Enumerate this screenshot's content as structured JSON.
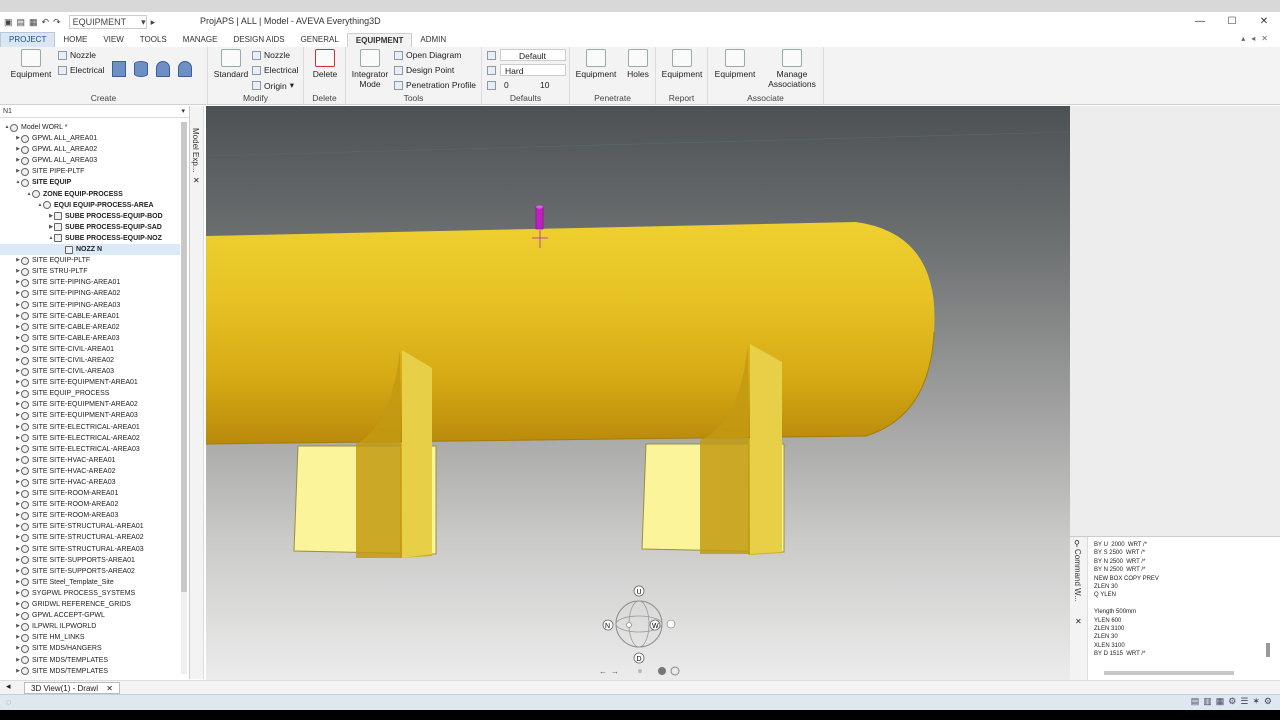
{
  "window": {
    "title": "ProjAPS | ALL | Model - AVEVA Everything3D",
    "quick_combo": "EQUIPMENT",
    "buttons": [
      "—",
      "☐",
      "✕"
    ]
  },
  "tabs": [
    "PROJECT",
    "HOME",
    "VIEW",
    "TOOLS",
    "MANAGE",
    "DESIGN AIDS",
    "GENERAL",
    "EQUIPMENT",
    "ADMIN"
  ],
  "ribbon": {
    "create": {
      "label": "Create",
      "equipment": "Equipment",
      "nozzle": "Nozzle",
      "electrical": "Electrical"
    },
    "modify": {
      "label": "Modify",
      "standard": "Standard",
      "nozzle": "Nozzle",
      "electrical": "Electrical",
      "origin": "Origin"
    },
    "delete": {
      "label": "Delete",
      "delete": "Delete"
    },
    "tools": {
      "label": "Tools",
      "integrator": "Integrator",
      "mode": "Mode",
      "open_diagram": "Open Diagram",
      "design_point": "Design Point",
      "penetration_profile": "Penetration Profile"
    },
    "defaults": {
      "label": "Defaults",
      "default": "Default",
      "hard": "Hard",
      "val1": "0",
      "val2": "10"
    },
    "penetrate": {
      "label": "Penetrate",
      "equipment": "Equipment",
      "holes": "Holes"
    },
    "report": {
      "label": "Report",
      "equipment": "Equipment"
    },
    "associate": {
      "label": "Associate",
      "equipment": "Equipment",
      "manage": "Manage",
      "associations": "Associations"
    }
  },
  "tree": {
    "header": "N1",
    "items": [
      {
        "label": "Model WORL *",
        "indent": 0,
        "exp": "▲",
        "bold": false
      },
      {
        "label": "GPWL ALL_AREA01",
        "indent": 1,
        "exp": "▶",
        "bold": false
      },
      {
        "label": "GPWL ALL_AREA02",
        "indent": 1,
        "exp": "▶",
        "bold": false
      },
      {
        "label": "GPWL ALL_AREA03",
        "indent": 1,
        "exp": "▶",
        "bold": false
      },
      {
        "label": "SITE PIPE-PLTF",
        "indent": 1,
        "exp": "▶",
        "bold": false
      },
      {
        "label": "SITE EQUIP",
        "indent": 1,
        "exp": "▲",
        "bold": true
      },
      {
        "label": "ZONE EQUIP-PROCESS",
        "indent": 2,
        "exp": "▲",
        "bold": true
      },
      {
        "label": "EQUI EQUIP-PROCESS-AREA",
        "indent": 3,
        "exp": "▲",
        "bold": true
      },
      {
        "label": "SUBE PROCESS-EQUIP-BOD",
        "indent": 4,
        "exp": "▶",
        "bold": true
      },
      {
        "label": "SUBE PROCESS-EQUIP-SAD",
        "indent": 4,
        "exp": "▶",
        "bold": true
      },
      {
        "label": "SUBE PROCESS-EQUIP-NOZ",
        "indent": 4,
        "exp": "▲",
        "bold": true
      },
      {
        "label": "NOZZ N",
        "indent": 5,
        "exp": "",
        "bold": true,
        "sel": true
      },
      {
        "label": "SITE EQUIP-PLTF",
        "indent": 1,
        "exp": "▶",
        "bold": false
      },
      {
        "label": "SITE STRU-PLTF",
        "indent": 1,
        "exp": "▶",
        "bold": false
      },
      {
        "label": "SITE SITE-PIPING-AREA01",
        "indent": 1,
        "exp": "▶",
        "bold": false
      },
      {
        "label": "SITE SITE-PIPING-AREA02",
        "indent": 1,
        "exp": "▶",
        "bold": false
      },
      {
        "label": "SITE SITE-PIPING-AREA03",
        "indent": 1,
        "exp": "▶",
        "bold": false
      },
      {
        "label": "SITE SITE-CABLE-AREA01",
        "indent": 1,
        "exp": "▶",
        "bold": false
      },
      {
        "label": "SITE SITE-CABLE-AREA02",
        "indent": 1,
        "exp": "▶",
        "bold": false
      },
      {
        "label": "SITE SITE-CABLE-AREA03",
        "indent": 1,
        "exp": "▶",
        "bold": false
      },
      {
        "label": "SITE SITE-CIVIL-AREA01",
        "indent": 1,
        "exp": "▶",
        "bold": false
      },
      {
        "label": "SITE SITE-CIVIL-AREA02",
        "indent": 1,
        "exp": "▶",
        "bold": false
      },
      {
        "label": "SITE SITE-CIVIL-AREA03",
        "indent": 1,
        "exp": "▶",
        "bold": false
      },
      {
        "label": "SITE SITE-EQUIPMENT-AREA01",
        "indent": 1,
        "exp": "▶",
        "bold": false
      },
      {
        "label": "SITE EQUIP_PROCESS",
        "indent": 1,
        "exp": "▶",
        "bold": false
      },
      {
        "label": "SITE SITE-EQUIPMENT-AREA02",
        "indent": 1,
        "exp": "▶",
        "bold": false
      },
      {
        "label": "SITE SITE-EQUIPMENT-AREA03",
        "indent": 1,
        "exp": "▶",
        "bold": false
      },
      {
        "label": "SITE SITE-ELECTRICAL-AREA01",
        "indent": 1,
        "exp": "▶",
        "bold": false
      },
      {
        "label": "SITE SITE-ELECTRICAL-AREA02",
        "indent": 1,
        "exp": "▶",
        "bold": false
      },
      {
        "label": "SITE SITE-ELECTRICAL-AREA03",
        "indent": 1,
        "exp": "▶",
        "bold": false
      },
      {
        "label": "SITE SITE-HVAC-AREA01",
        "indent": 1,
        "exp": "▶",
        "bold": false
      },
      {
        "label": "SITE SITE-HVAC-AREA02",
        "indent": 1,
        "exp": "▶",
        "bold": false
      },
      {
        "label": "SITE SITE-HVAC-AREA03",
        "indent": 1,
        "exp": "▶",
        "bold": false
      },
      {
        "label": "SITE SITE-ROOM-AREA01",
        "indent": 1,
        "exp": "▶",
        "bold": false
      },
      {
        "label": "SITE SITE-ROOM-AREA02",
        "indent": 1,
        "exp": "▶",
        "bold": false
      },
      {
        "label": "SITE SITE-ROOM-AREA03",
        "indent": 1,
        "exp": "▶",
        "bold": false
      },
      {
        "label": "SITE SITE-STRUCTURAL-AREA01",
        "indent": 1,
        "exp": "▶",
        "bold": false
      },
      {
        "label": "SITE SITE-STRUCTURAL-AREA02",
        "indent": 1,
        "exp": "▶",
        "bold": false
      },
      {
        "label": "SITE SITE-STRUCTURAL-AREA03",
        "indent": 1,
        "exp": "▶",
        "bold": false
      },
      {
        "label": "SITE SITE-SUPPORTS-AREA01",
        "indent": 1,
        "exp": "▶",
        "bold": false
      },
      {
        "label": "SITE SITE-SUPPORTS-AREA02",
        "indent": 1,
        "exp": "▶",
        "bold": false
      },
      {
        "label": "SITE Steel_Template_Site",
        "indent": 1,
        "exp": "▶",
        "bold": false
      },
      {
        "label": "SYGPWL PROCESS_SYSTEMS",
        "indent": 1,
        "exp": "▶",
        "bold": false
      },
      {
        "label": "GRIDWL REFERENCE_GRIDS",
        "indent": 1,
        "exp": "▶",
        "bold": false
      },
      {
        "label": "GPWL ACCEPT-GPWL",
        "indent": 1,
        "exp": "▶",
        "bold": false
      },
      {
        "label": "ILPWRL ILPWORLD",
        "indent": 1,
        "exp": "▶",
        "bold": false
      },
      {
        "label": "SITE HM_LINKS",
        "indent": 1,
        "exp": "▶",
        "bold": false
      },
      {
        "label": "SITE MDS/HANGERS",
        "indent": 1,
        "exp": "▶",
        "bold": false
      },
      {
        "label": "SITE MDS/TEMPLATES",
        "indent": 1,
        "exp": "▶",
        "bold": false
      },
      {
        "label": "SITE MDS/TEMPLATES",
        "indent": 1,
        "exp": "▶",
        "bold": false
      }
    ]
  },
  "side_tabs": {
    "model_explorer": "Model Exp...",
    "command_window": "Command W..."
  },
  "compass": {
    "up": "U",
    "down": "D",
    "north": "N",
    "west": "W"
  },
  "command_lines": [
    "BY U  2000  WRT /*",
    "BY S 2500  WRT /*",
    "BY N 2500  WRT /*",
    "BY N 2500  WRT /*",
    "NEW BOX COPY PREV",
    "ZLEN 30",
    "Q YLEN",
    "",
    "Ylength 500mm",
    "YLEN 600",
    "ZLEN 3100",
    "ZLEN 30",
    "XLEN 3100",
    "BY D 1515  WRT /*"
  ],
  "bottom_tab": "3D View(1) - Drawl",
  "colors": {
    "vessel": "#d9b21c",
    "saddle": "#f7f08a",
    "nozzle": "#c21ec4"
  }
}
